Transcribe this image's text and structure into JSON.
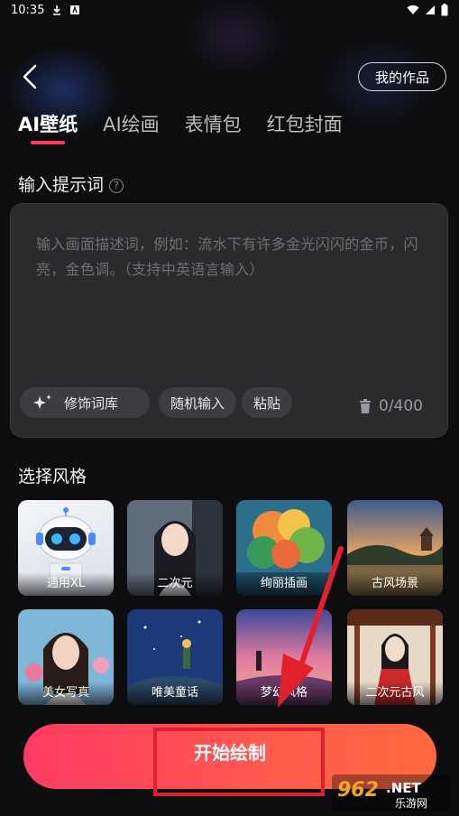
{
  "status_bar": {
    "time": "10:35"
  },
  "header": {
    "my_works_label": "我的作品"
  },
  "tabs": [
    {
      "label": "AI壁纸"
    },
    {
      "label": "AI绘画"
    },
    {
      "label": "表情包"
    },
    {
      "label": "红包封面"
    }
  ],
  "prompt": {
    "section_title": "输入提示词",
    "placeholder": "输入画面描述词，例如：流水下有许多金光闪闪的金币，闪亮，金色调。（支持中英语言输入）",
    "chips": [
      "修饰词库",
      "随机输入",
      "粘贴"
    ],
    "counter": "0/400"
  },
  "styles": {
    "section_title": "选择风格",
    "items": [
      {
        "label": "通用XL"
      },
      {
        "label": "二次元"
      },
      {
        "label": "绚丽插画"
      },
      {
        "label": "古风场景"
      },
      {
        "label": "美女写真"
      },
      {
        "label": "唯美童话"
      },
      {
        "label": "梦幻风格"
      },
      {
        "label": "二次元古风"
      }
    ]
  },
  "start_button_label": "开始绘制",
  "watermark": {
    "number": "962",
    "suffix": ".NET",
    "site": "乐游网"
  },
  "colors": {
    "accent": "#ff3b5c",
    "background": "#0d0d0f",
    "annotation": "#e0202c"
  }
}
